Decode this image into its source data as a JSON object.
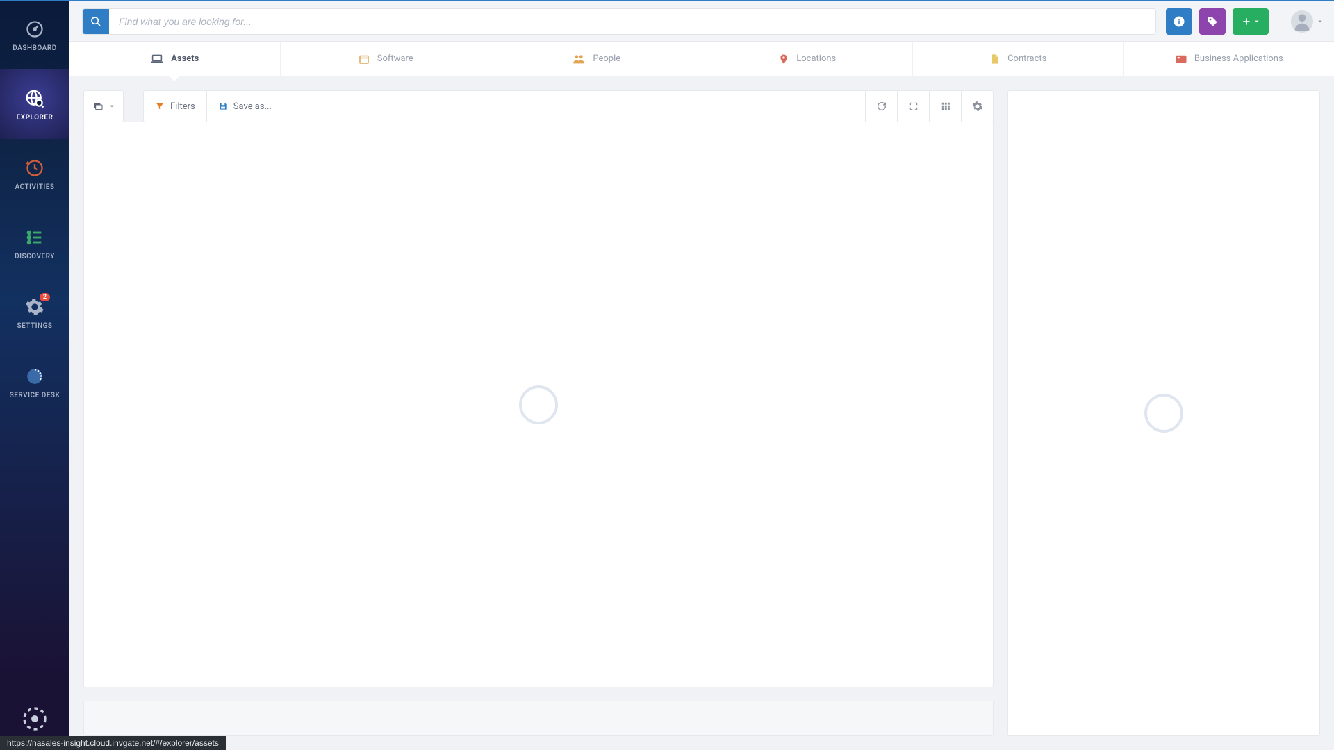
{
  "sidebar": {
    "items": [
      {
        "label": "DASHBOARD",
        "icon": "gauge-icon"
      },
      {
        "label": "EXPLORER",
        "icon": "globe-search-icon"
      },
      {
        "label": "ACTIVITIES",
        "icon": "clock-icon"
      },
      {
        "label": "DISCOVERY",
        "icon": "list-icon"
      },
      {
        "label": "SETTINGS",
        "icon": "gear-icon",
        "badge": "2"
      },
      {
        "label": "SERVICE DESK",
        "icon": "ticket-icon"
      }
    ]
  },
  "search": {
    "placeholder": "Find what you are looking for..."
  },
  "subnav": {
    "tabs": [
      {
        "label": "Assets",
        "icon": "laptop-icon"
      },
      {
        "label": "Software",
        "icon": "box-icon"
      },
      {
        "label": "People",
        "icon": "people-icon"
      },
      {
        "label": "Locations",
        "icon": "pin-icon"
      },
      {
        "label": "Contracts",
        "icon": "document-icon"
      },
      {
        "label": "Business Applications",
        "icon": "app-icon"
      }
    ]
  },
  "toolbar": {
    "filters_label": "Filters",
    "save_as_label": "Save as..."
  },
  "status_url": "https://nasales-insight.cloud.invgate.net/#/explorer/assets"
}
